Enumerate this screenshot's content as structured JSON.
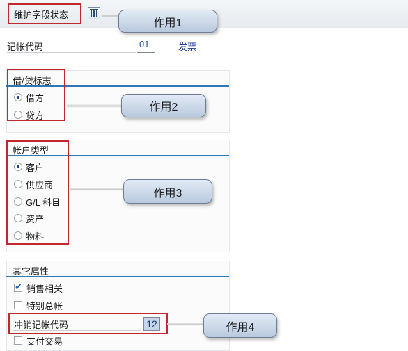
{
  "header": {
    "title": "维护字段状态",
    "icon": "grid-icon"
  },
  "posting_key": {
    "label": "记帐代码",
    "value": "01",
    "description": "发票"
  },
  "debit_credit": {
    "title": "借/贷标志",
    "options": [
      "借方",
      "贷方"
    ],
    "selected": "借方"
  },
  "account_type": {
    "title": "帐户类型",
    "options": [
      "客户",
      "供应商",
      "G/L 科目",
      "资产",
      "物料"
    ],
    "selected": "客户"
  },
  "other_attributes": {
    "title": "其它属性",
    "sales_related": {
      "label": "销售相关",
      "checked": true
    },
    "special_gl": {
      "label": "特别总帐",
      "checked": false
    },
    "reversal_key": {
      "label": "冲销记帐代码",
      "value": "12"
    },
    "payment_transaction": {
      "label": "支付交易",
      "checked": false
    }
  },
  "callouts": [
    "作用1",
    "作用2",
    "作用3",
    "作用4"
  ],
  "colors": {
    "highlight": "#c0282d",
    "section_line": "#2f78b5",
    "callout_fill": "#c8d6e8"
  }
}
